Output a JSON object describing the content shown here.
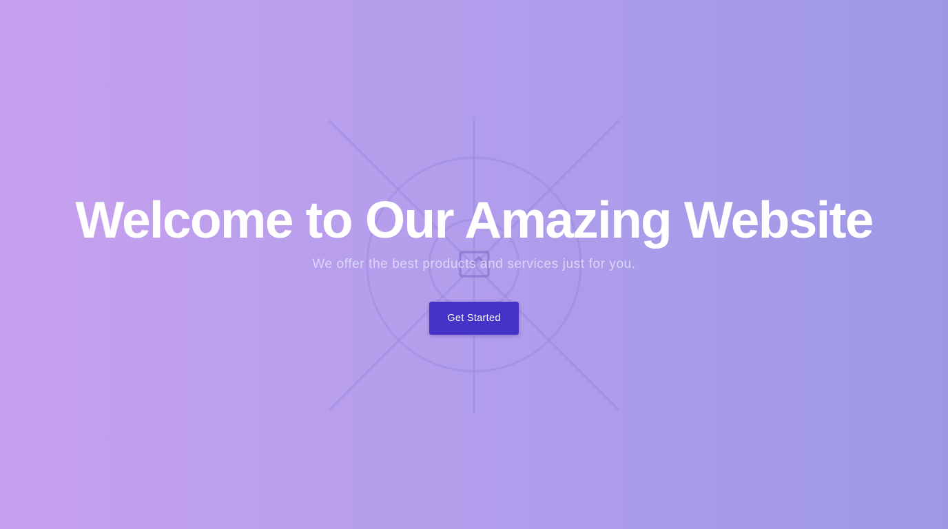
{
  "hero": {
    "title": "Welcome to Our Amazing Website",
    "subtitle": "We offer the best products and services just for you.",
    "cta_label": "Get Started",
    "background_icon": "image-placeholder-icon"
  },
  "colors": {
    "gradient_start": "#c7a0ef",
    "gradient_end": "#9d98e6",
    "title": "#ffffff",
    "button_bg": "#4532c7",
    "button_text": "#ffffff"
  }
}
